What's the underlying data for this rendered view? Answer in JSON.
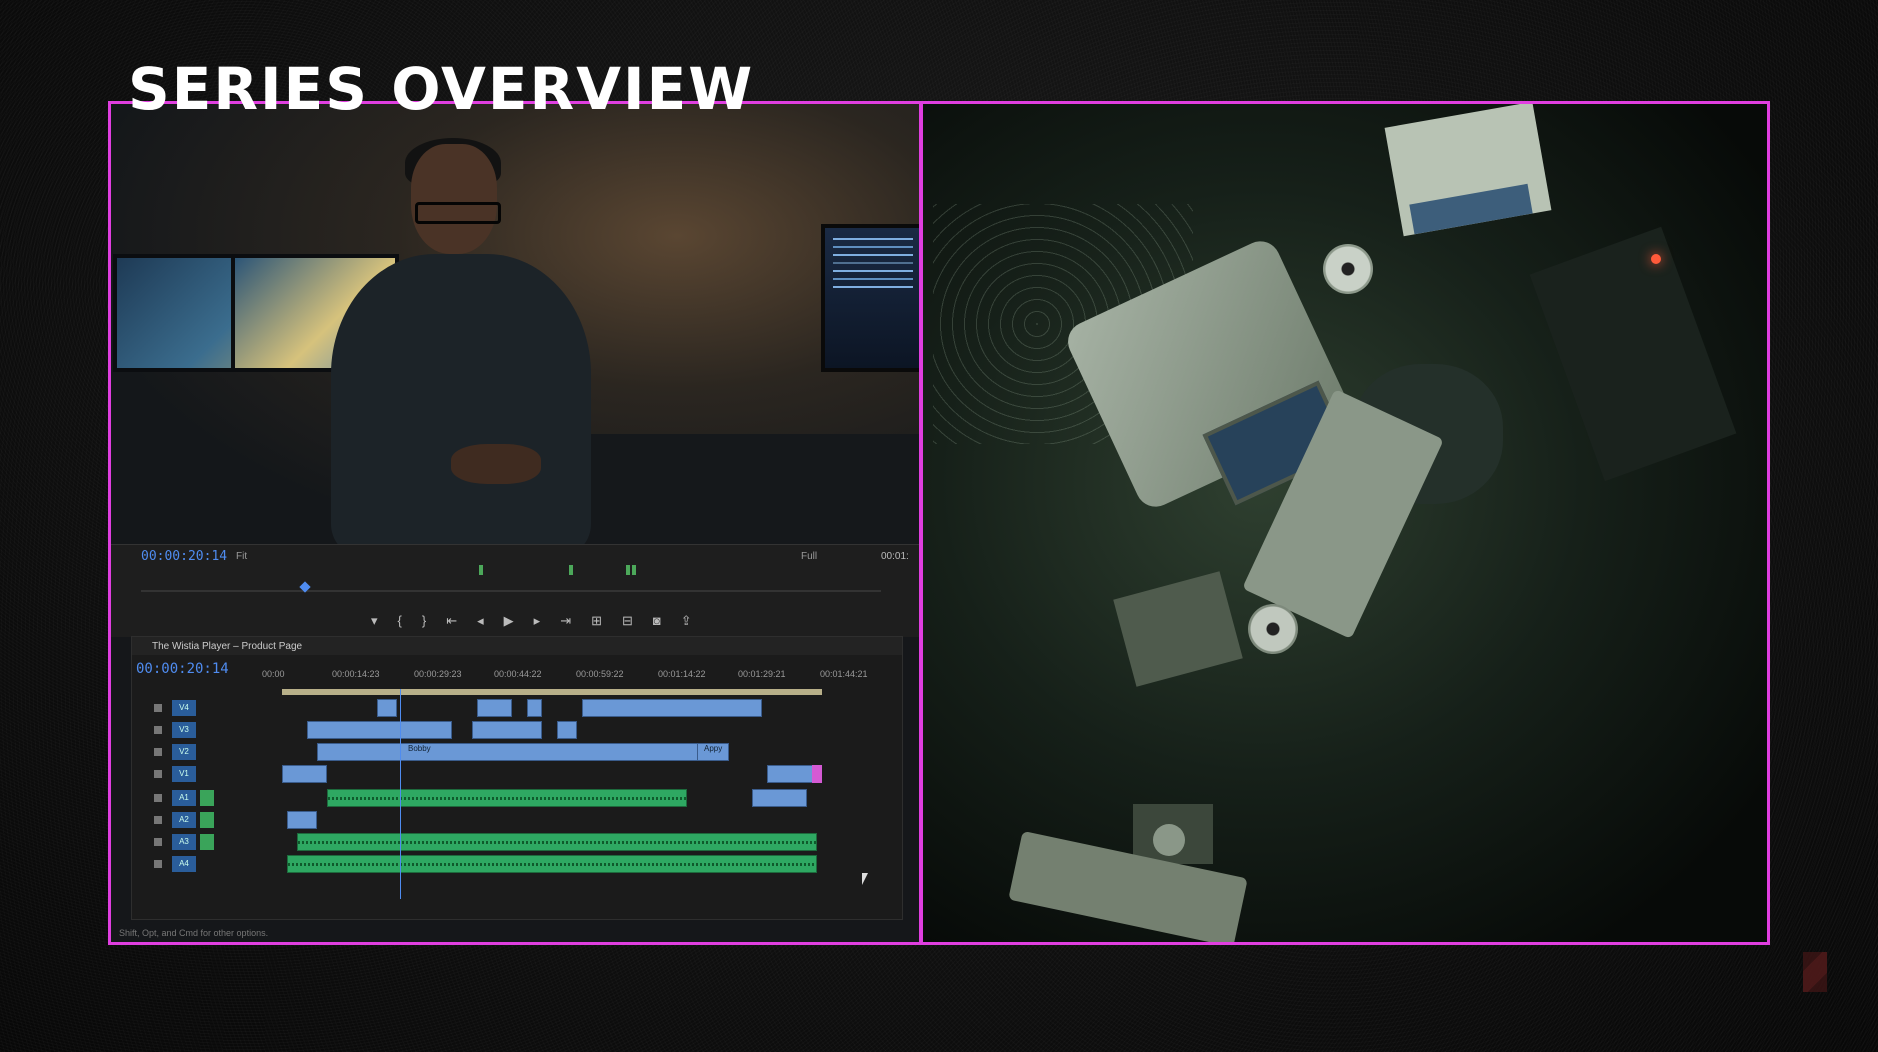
{
  "slide": {
    "title": "SERIES OVERVIEW",
    "accent_color": "#e03ee0",
    "logo_icon": "netflix-n-logo"
  },
  "program_monitor": {
    "timecode": "00:00:20:14",
    "fit_label": "Fit",
    "quality_label": "Full",
    "end_timecode": "00:01:"
  },
  "timeline": {
    "sequence_name": "The Wistia Player – Product Page",
    "timecode": "00:00:20:14",
    "ruler_labels": [
      "00:00",
      "00:00:14:23",
      "00:00:29:23",
      "00:00:44:22",
      "00:00:59:22",
      "00:01:14:22",
      "00:01:29:21",
      "00:01:44:21"
    ],
    "video_tracks": [
      "V4",
      "V3",
      "V2",
      "V1"
    ],
    "audio_tracks": [
      "A1",
      "A2",
      "A3",
      "A4"
    ],
    "clip_labels": [
      "Bobby",
      "Appy"
    ]
  },
  "status_hint": "Shift, Opt, and Cmd for other options."
}
